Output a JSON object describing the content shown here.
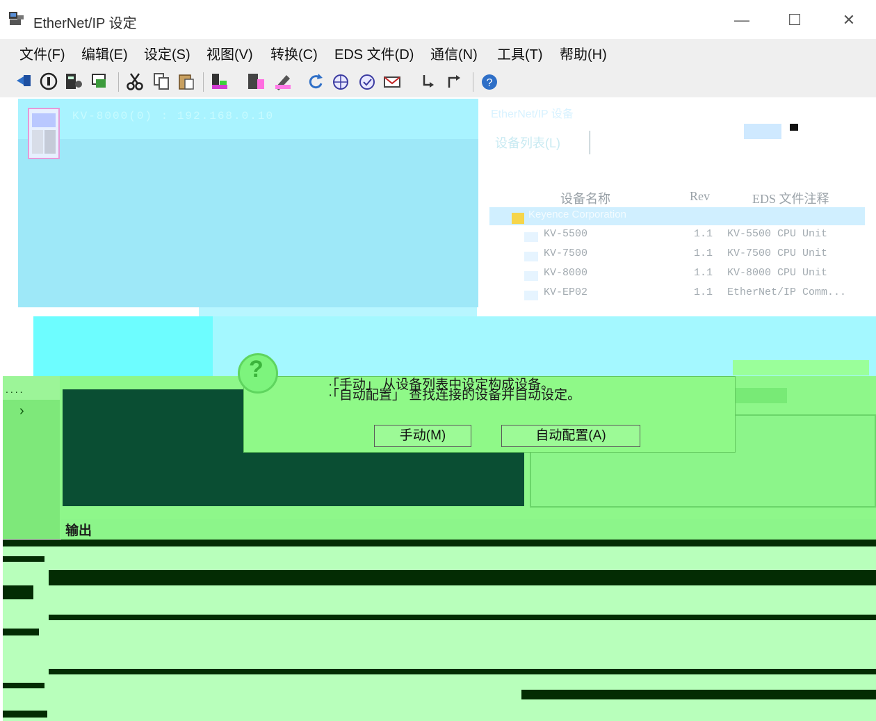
{
  "window": {
    "title": "EtherNet/IP 设定",
    "controls": {
      "minimize": "—",
      "maximize": "☐",
      "close": "✕"
    }
  },
  "menu": [
    {
      "label": "文件(F)"
    },
    {
      "label": "编辑(E)"
    },
    {
      "label": "设定(S)"
    },
    {
      "label": "视图(V)"
    },
    {
      "label": "转换(C)"
    },
    {
      "label": "EDS 文件(D)"
    },
    {
      "label": "通信(N)"
    },
    {
      "label": "工具(T)"
    },
    {
      "label": "帮助(H)"
    }
  ],
  "toolbar": {
    "icons": [
      "pin-icon",
      "info-icon",
      "device-settings-icon",
      "monitor-icon",
      "cut-icon",
      "copy-icon",
      "paste-icon",
      "rack-icon",
      "rack-add-icon",
      "pen-icon",
      "refresh-icon",
      "globe-icon",
      "globe-check-icon",
      "mail-icon",
      "arrow-down-icon",
      "arrow-up-icon",
      "help-icon"
    ]
  },
  "tree": {
    "device_label": "KV-8000(0) : 192.168.0.10"
  },
  "device_list": {
    "header": "EtherNet/IP 设备",
    "list_label": "设备列表(L)",
    "columns": [
      "设备名称",
      "Rev",
      "EDS 文件注释"
    ],
    "vendor": "Keyence Corporation",
    "rows": [
      {
        "name": "KV-5500",
        "rev": "1.1",
        "eds": "KV-5500 CPU Unit"
      },
      {
        "name": "KV-7500",
        "rev": "1.1",
        "eds": "KV-7500 CPU Unit"
      },
      {
        "name": "KV-8000",
        "rev": "1.1",
        "eds": "KV-8000 CPU Unit"
      },
      {
        "name": "KV-EP02",
        "rev": "1.1",
        "eds": "EtherNet/IP Comm..."
      }
    ]
  },
  "dialog": {
    "line1": "·「手动」   从设备列表中设定构成设备。",
    "line2": "·「自动配置」   查找连接的设备并自动设定。",
    "manual_button": "手动(M)",
    "auto_button": "自动配置(A)"
  },
  "left_panel": {
    "chevron": "›",
    "dots": "...."
  },
  "output": {
    "label": "输出"
  },
  "colors": {
    "tree_bg": "#9ee8f8",
    "dialog_bg": "#8ff988",
    "dark_panel": "#0a4e33",
    "output_bg": "#b8ffbb"
  }
}
